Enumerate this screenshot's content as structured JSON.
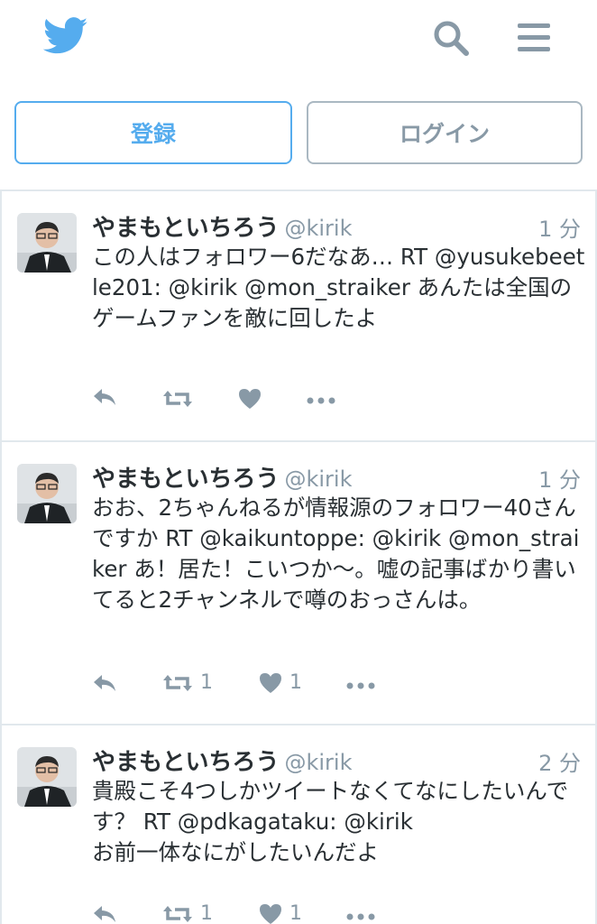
{
  "header": {
    "logo_icon": "twitter-bird-icon",
    "search_icon": "search-icon",
    "menu_icon": "hamburger-menu-icon",
    "brand_color": "#55acee"
  },
  "buttons": {
    "signup_label": "登録",
    "login_label": "ログイン"
  },
  "tweets": [
    {
      "name": "やまもといちろう",
      "handle": "@kirik",
      "time": "1 分",
      "text": "この人はフォロワー6だなあ… RT @yusukebeetle201: @kirik @mon_straiker あんたは全国のゲームファンを敵に回したよ",
      "retweets": "",
      "likes": ""
    },
    {
      "name": "やまもといちろう",
      "handle": "@kirik",
      "time": "1 分",
      "text": "おお、2ちゃんねるが情報源のフォロワー40さんですか RT @kaikuntoppe: @kirik @mon_straiker あ！居た！こいつか～。嘘の記事ばかり書いてると2チャンネルで噂のおっさんは。",
      "retweets": "1",
      "likes": "1"
    },
    {
      "name": "やまもといちろう",
      "handle": "@kirik",
      "time": "2 分",
      "text": "貴殿こそ4つしかツイートなくてなにしたいんです？ RT @pdkagataku: @kirik\nお前一体なにがしたいんだよ",
      "retweets": "1",
      "likes": "1"
    }
  ]
}
